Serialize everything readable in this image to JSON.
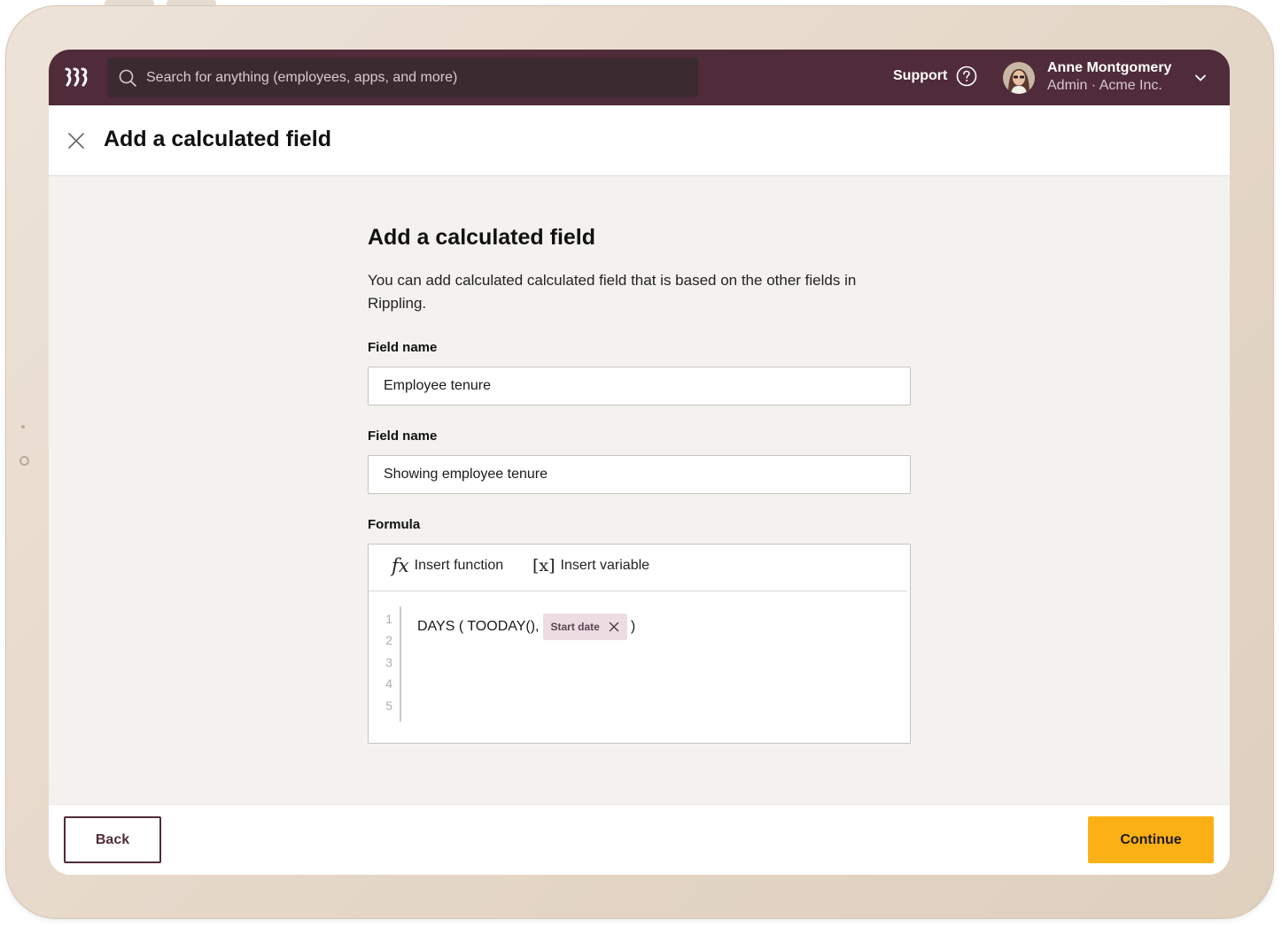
{
  "topbar": {
    "logo_icon": "rippling-logo-icon",
    "search": {
      "placeholder": "Search for anything (employees, apps, and more)",
      "value": ""
    },
    "support_label": "Support",
    "user": {
      "name": "Anne Montgomery",
      "role": "Admin · Acme Inc."
    }
  },
  "header": {
    "title": "Add a calculated field"
  },
  "form": {
    "title": "Add a calculated field",
    "description": "You can add calculated calculated field that is based on the other fields in Rippling.",
    "field1": {
      "label": "Field name",
      "value": "Employee tenure"
    },
    "field2": {
      "label": "Field name",
      "value": "Showing employee tenure"
    },
    "formula": {
      "label": "Formula",
      "insert_function_label": "Insert function",
      "insert_variable_label": "Insert variable",
      "fx_glyph": "fx",
      "var_glyph": "[x]",
      "line_numbers": [
        "1",
        "2",
        "3",
        "4",
        "5"
      ],
      "code_prefix": "DAYS ( TOODAY(),",
      "chip_label": "Start date",
      "code_suffix": ")"
    }
  },
  "footer": {
    "back_label": "Back",
    "continue_label": "Continue"
  },
  "colors": {
    "brand": "#502b3a",
    "accent": "#fbb116",
    "chip_bg": "#eddde3"
  }
}
